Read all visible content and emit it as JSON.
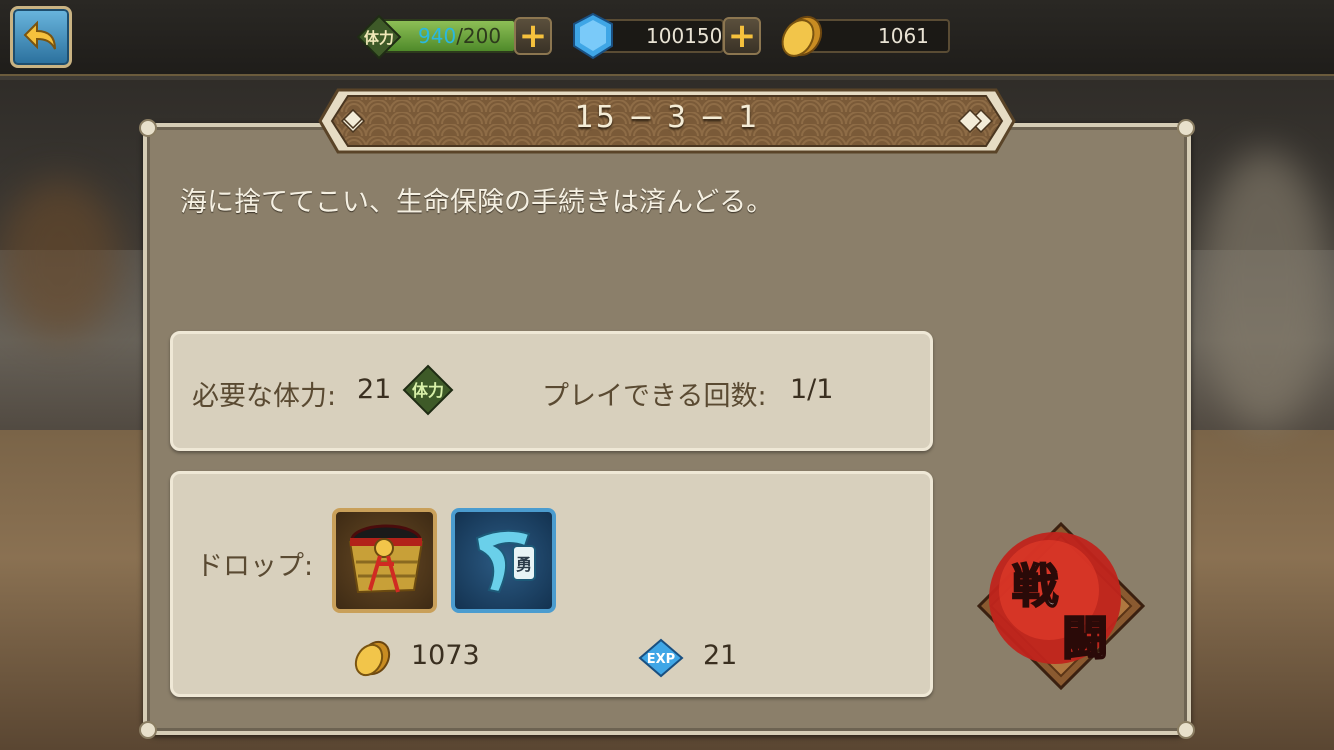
{
  "header": {
    "stamina": {
      "current": "940",
      "max": "/200",
      "icon_label": "体力"
    },
    "gems": {
      "value": "100150"
    },
    "coins": {
      "value": "1061"
    }
  },
  "stage": {
    "title": "15 − 3 − 1",
    "description": "海に捨ててこい、生命保険の手続きは済んどる。"
  },
  "requirements": {
    "stamina_label": "必要な体力:",
    "stamina_value": "21",
    "plays_label": "プレイできる回数:",
    "plays_value": "1/1"
  },
  "drops": {
    "label": "ドロップ:",
    "items": [
      {
        "name": "armor-belt-item",
        "badge": ""
      },
      {
        "name": "blue-headband-item",
        "badge": "勇"
      }
    ],
    "coin_reward": "1073",
    "exp_label": "EXP",
    "exp_reward": "21"
  },
  "battle_button": {
    "line1": "戦",
    "line2": "闘"
  },
  "colors": {
    "panel": "#8b7f6a",
    "info_box": "#d8d0bd",
    "stamina_green": "#8dbf56",
    "accent_gold": "#f6c13d",
    "battle_red": "#c0241c"
  }
}
